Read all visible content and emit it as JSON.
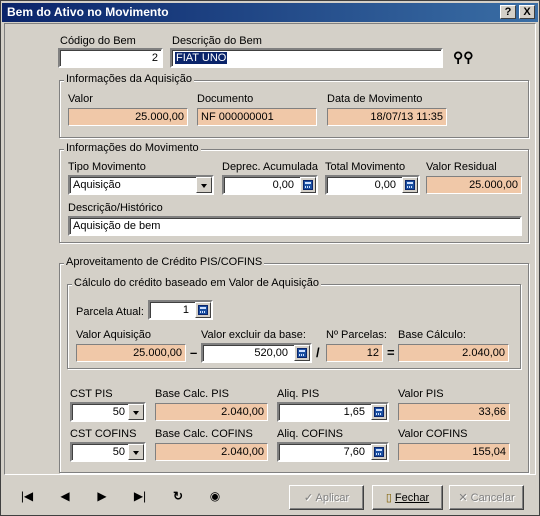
{
  "window": {
    "title": "Bem do Ativo no Movimento",
    "help_btn": "?",
    "close_btn": "X"
  },
  "bem": {
    "codigo_label": "Código do Bem",
    "codigo_value": "2",
    "descricao_label": "Descrição do Bem",
    "descricao_value": "FIAT UNO"
  },
  "aquisicao": {
    "caption": "Informações da Aquisição",
    "valor_label": "Valor",
    "valor": "25.000,00",
    "documento_label": "Documento",
    "documento": "NF 000000001",
    "data_label": "Data de Movimento",
    "data": "18/07/13  11:35"
  },
  "movimento": {
    "caption": "Informações do Movimento",
    "tipo_label": "Tipo Movimento",
    "tipo_value": "Aquisição",
    "deprec_label": "Deprec. Acumulada",
    "deprec_value": "0,00",
    "total_label": "Total Movimento",
    "total_value": "0,00",
    "residual_label": "Valor Residual",
    "residual_value": "25.000,00",
    "historico_label": "Descrição/Histórico",
    "historico_value": "Aquisição de bem"
  },
  "credito": {
    "caption": "Aproveitamento de Crédito PIS/COFINS",
    "calc_caption": "Cálculo do crédito baseado em Valor de Aquisição",
    "parcela_label": "Parcela Atual:",
    "parcela_value": "1",
    "valor_aquisicao_label": "Valor Aquisição",
    "valor_aquisicao": "25.000,00",
    "valor_excluir_label": "Valor excluir da base:",
    "valor_excluir": "520,00",
    "n_parcelas_label": "Nº Parcelas:",
    "n_parcelas": "12",
    "base_calculo_label": "Base Cálculo:",
    "base_calculo": "2.040,00",
    "op_minus": "–",
    "op_div": "/",
    "op_eq": "=",
    "cst_pis_label": "CST PIS",
    "cst_pis": "50",
    "base_pis_label": "Base Calc. PIS",
    "base_pis": "2.040,00",
    "aliq_pis_label": "Aliq. PIS",
    "aliq_pis": "1,65",
    "valor_pis_label": "Valor PIS",
    "valor_pis": "33,66",
    "cst_cofins_label": "CST COFINS",
    "cst_cofins": "50",
    "base_cofins_label": "Base Calc. COFINS",
    "base_cofins": "2.040,00",
    "aliq_cofins_label": "Aliq. COFINS",
    "aliq_cofins": "7,60",
    "valor_cofins_label": "Valor COFINS",
    "valor_cofins": "155,04"
  },
  "nav": {
    "first": "|◀",
    "prev": "◀",
    "next": "▶",
    "last": "▶|",
    "refresh": "↻",
    "record": "◉"
  },
  "buttons": {
    "apply": "Aplicar",
    "close": "Fechar",
    "cancel": "Cancelar"
  },
  "colors": {
    "readonly_bg": "#f0c8a8",
    "title_bg": "#0a246a"
  }
}
